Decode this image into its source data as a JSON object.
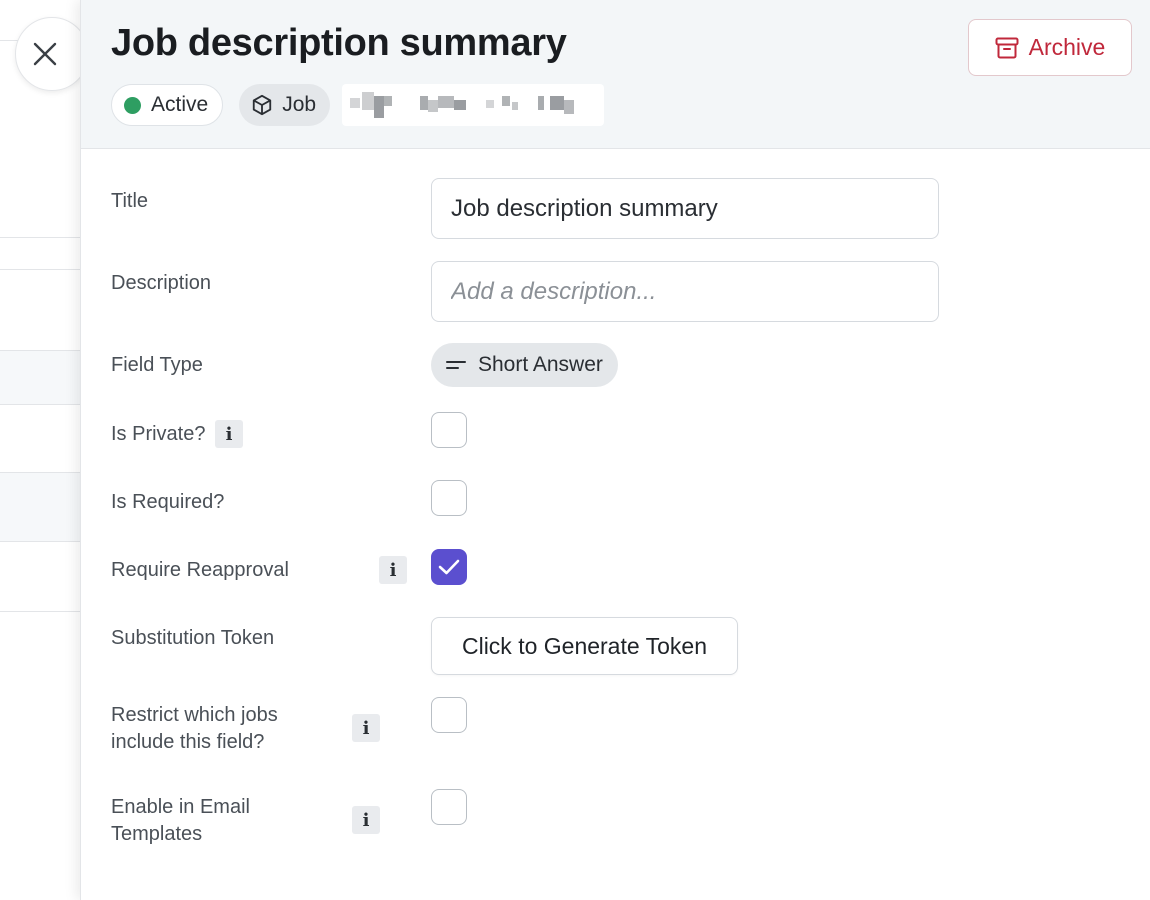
{
  "header": {
    "title": "Job description summary",
    "archive_label": "Archive",
    "status_label": "Active",
    "type_label": "Job"
  },
  "colors": {
    "status_active": "#2e9e62",
    "archive": "#c0283b",
    "checkbox_checked": "#5b4fcf"
  },
  "icons": {
    "close": "close-icon",
    "archive": "archive-box-icon",
    "type": "cube-icon",
    "field_type": "short-answer-lines-icon",
    "info": "info-icon",
    "check": "checkmark-icon"
  },
  "form": {
    "title_label": "Title",
    "title_value": "Job description summary",
    "description_label": "Description",
    "description_placeholder": "Add a description...",
    "field_type_label": "Field Type",
    "field_type_value": "Short Answer",
    "info_glyph": "i",
    "is_private_label": "Is Private?",
    "is_private_checked": false,
    "is_required_label": "Is Required?",
    "is_required_checked": false,
    "require_reapproval_label": "Require Reapproval",
    "require_reapproval_checked": true,
    "substitution_token_label": "Substitution Token",
    "generate_token_label": "Click to Generate Token",
    "restrict_jobs_label": "Restrict which jobs include this field?",
    "restrict_jobs_checked": false,
    "email_templates_label": "Enable in Email Templates",
    "email_templates_checked": false
  }
}
